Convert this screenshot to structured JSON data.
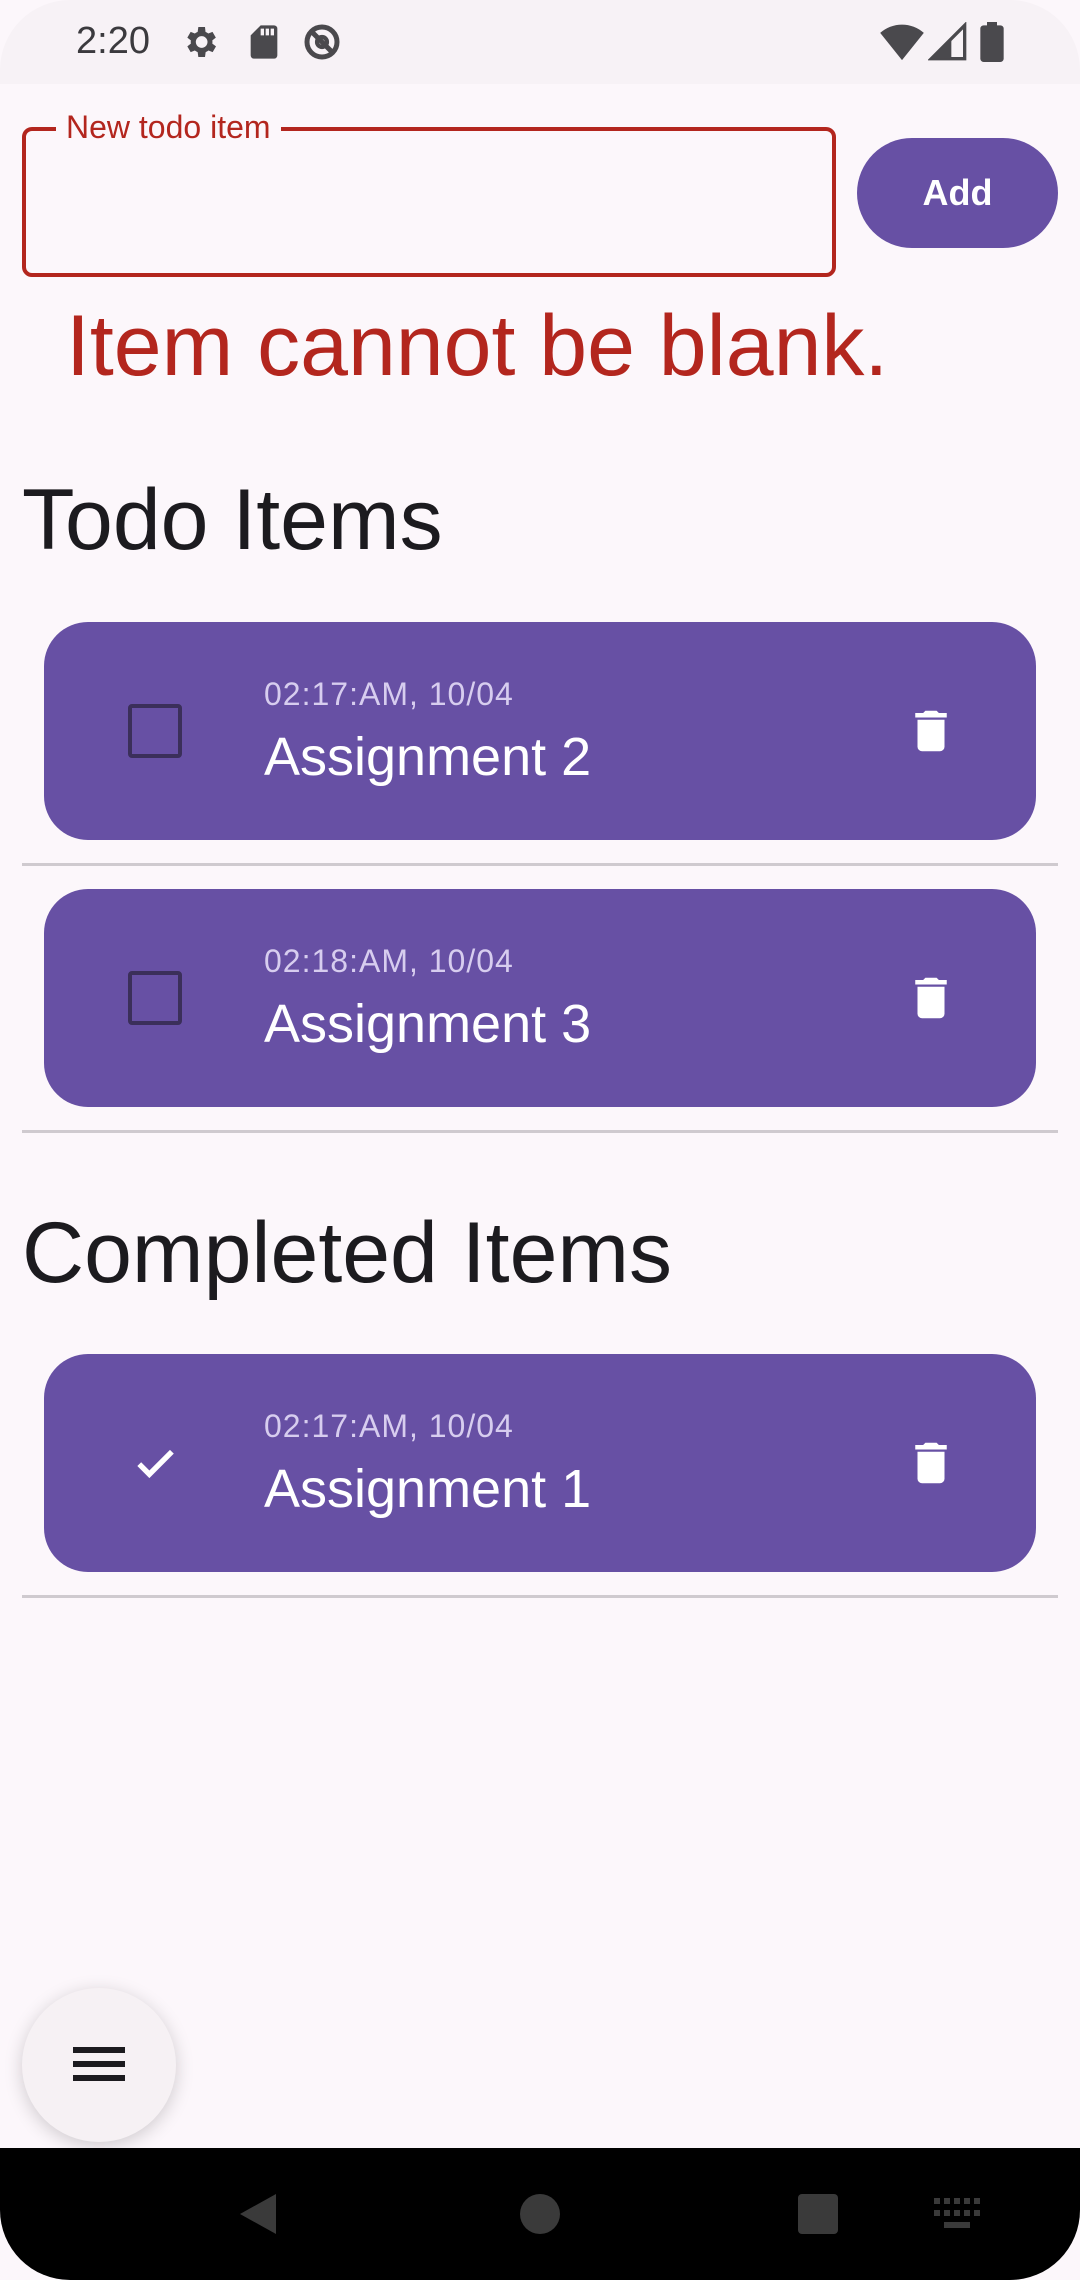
{
  "status_bar": {
    "time": "2:20",
    "left_icons": [
      "settings-icon",
      "sd-card-icon",
      "do-not-disturb-icon"
    ],
    "right_icons": [
      "wifi-icon",
      "signal-icon",
      "battery-icon"
    ]
  },
  "input": {
    "label": "New todo item",
    "value": "",
    "error": "Item cannot be blank."
  },
  "add_button": {
    "label": "Add"
  },
  "todo_section": {
    "title": "Todo Items",
    "items": [
      {
        "time": "02:17:AM, 10/04",
        "title": "Assignment 2",
        "checked": false
      },
      {
        "time": "02:18:AM, 10/04",
        "title": "Assignment 3",
        "checked": false
      }
    ]
  },
  "completed_section": {
    "title": "Completed Items",
    "items": [
      {
        "time": "02:17:AM, 10/04",
        "title": "Assignment 1",
        "checked": true
      }
    ]
  },
  "fab": {
    "icon": "menu-icon"
  },
  "nav_bar": {
    "icons": [
      "back-icon",
      "home-icon",
      "recents-icon",
      "keyboard-icon"
    ]
  },
  "colors": {
    "accent": "#6750a4",
    "error": "#b3261e",
    "background": "#fcf7fb"
  }
}
